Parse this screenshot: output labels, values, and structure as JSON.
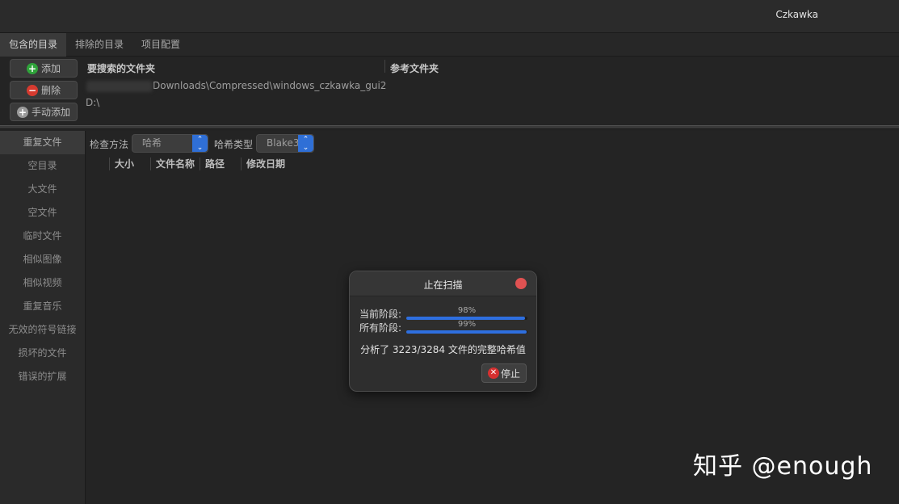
{
  "window": {
    "title": "Czkawka"
  },
  "tabs": [
    {
      "label": "包含的目录"
    },
    {
      "label": "排除的目录"
    },
    {
      "label": "项目配置"
    }
  ],
  "dirs": {
    "add": "添加",
    "remove": "删除",
    "manual_add": "手动添加",
    "col_search": "要搜索的文件夹",
    "col_reference": "参考文件夹",
    "paths": [
      "Downloads\\Compressed\\windows_czkawka_gui2",
      "D:\\"
    ]
  },
  "sidebar": {
    "items": [
      {
        "label": "重复文件"
      },
      {
        "label": "空目录"
      },
      {
        "label": "大文件"
      },
      {
        "label": "空文件"
      },
      {
        "label": "临时文件"
      },
      {
        "label": "相似图像"
      },
      {
        "label": "相似视频"
      },
      {
        "label": "重复音乐"
      },
      {
        "label": "无效的符号链接"
      },
      {
        "label": "损坏的文件"
      },
      {
        "label": "错误的扩展"
      }
    ]
  },
  "options": {
    "check_method_label": "检查方法",
    "check_method_value": "哈希",
    "hash_type_label": "哈希类型",
    "hash_type_value": "Blake3"
  },
  "table": {
    "columns": [
      "大小",
      "文件名称",
      "路径",
      "修改日期"
    ]
  },
  "dialog": {
    "title": "止在扫描",
    "current_stage_label": "当前阶段:",
    "current_stage_pct": "98%",
    "current_stage_value": 0.98,
    "all_stages_label": "所有阶段:",
    "all_stages_pct": "99%",
    "all_stages_value": 0.99,
    "message": "分析了 3223/3284 文件的完整哈希值",
    "stop": "停止"
  },
  "watermark": "知乎 @enough",
  "colors": {
    "accent": "#2e6fe0",
    "close": "#e05252"
  }
}
